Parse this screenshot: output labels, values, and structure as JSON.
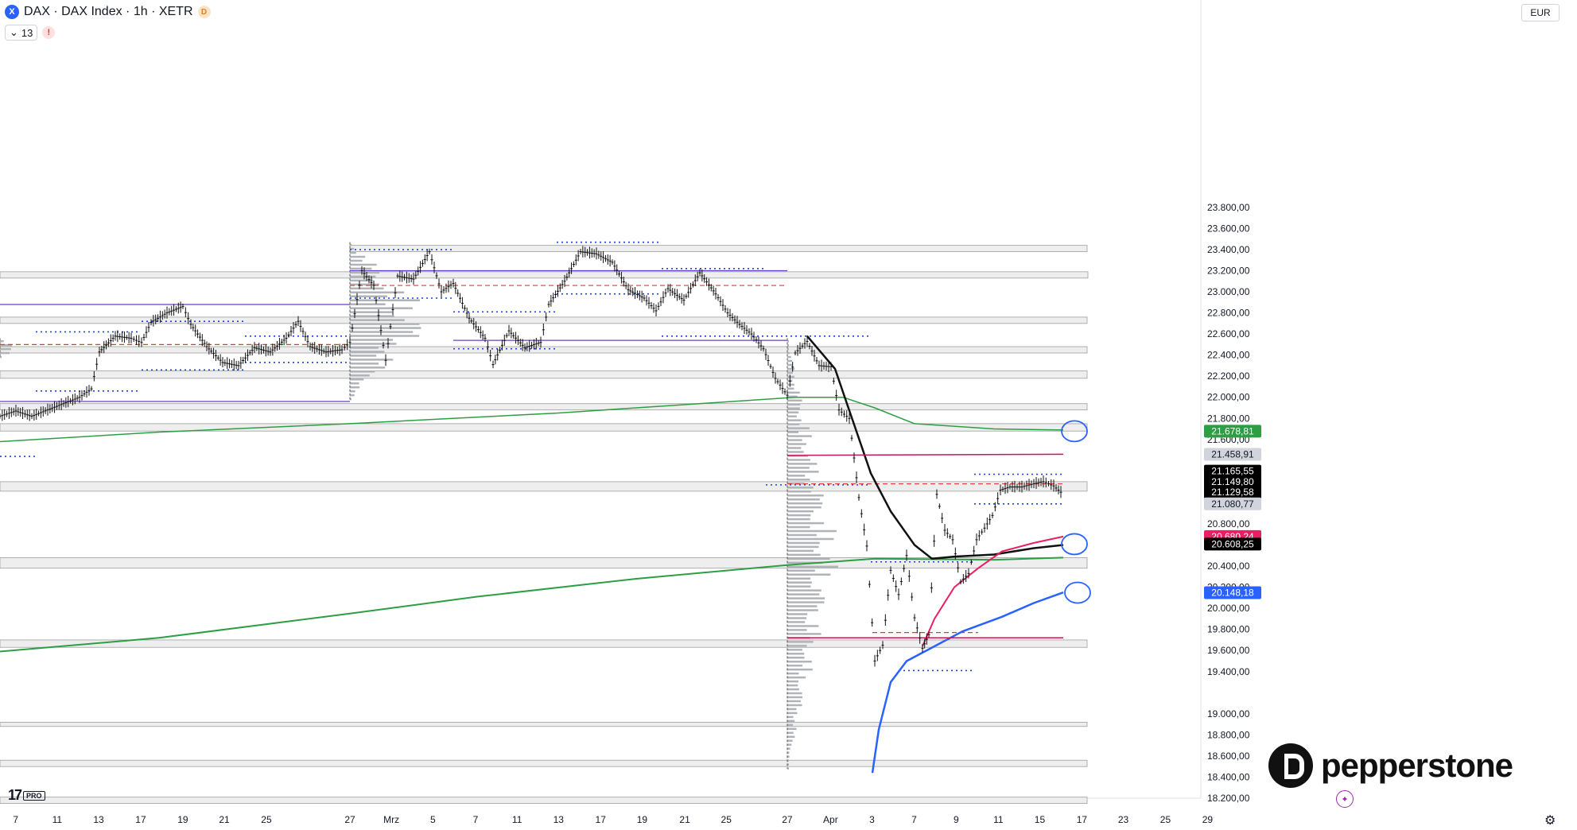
{
  "header": {
    "symbol_icon": "X",
    "title": "DAX · DAX Index · 1h · XETR",
    "badge": "D",
    "indicator_count": "13",
    "warning": "!"
  },
  "currency": "EUR",
  "branding": {
    "tv": "17",
    "pro": "PRO",
    "name": "pepperstone"
  },
  "icons": {
    "settings": "gear-icon",
    "assistant": "sparkle-icon",
    "symbol": "exchange-icon"
  },
  "chart_data": {
    "type": "candlestick",
    "ylim": [
      18200,
      23950
    ],
    "y_ticks": [
      "23.800,00",
      "23.600,00",
      "23.400,00",
      "23.200,00",
      "23.000,00",
      "22.800,00",
      "22.600,00",
      "22.400,00",
      "22.200,00",
      "22.000,00",
      "21.800,00",
      "21.600,00",
      "20.800,00",
      "20.400,00",
      "20.200,00",
      "20.000,00",
      "19.800,00",
      "19.600,00",
      "19.400,00",
      "19.000,00",
      "18.800,00",
      "18.600,00",
      "18.400,00",
      "18.200,00"
    ],
    "y_tick_values": [
      23800,
      23600,
      23400,
      23200,
      23000,
      22800,
      22600,
      22400,
      22200,
      22000,
      21800,
      21600,
      20800,
      20400,
      20200,
      20000,
      19800,
      19600,
      19400,
      19000,
      18800,
      18600,
      18400,
      18200
    ],
    "x_ticks": [
      "7",
      "11",
      "13",
      "17",
      "19",
      "21",
      "25",
      "27",
      "Mrz",
      "5",
      "7",
      "11",
      "13",
      "17",
      "19",
      "21",
      "25",
      "27",
      "Apr",
      "3",
      "7",
      "9",
      "11",
      "15",
      "17",
      "23",
      "25",
      "29"
    ],
    "price_labels": [
      {
        "text": "21.678,81",
        "value": 21678.81,
        "bg": "#2e9e44",
        "fg": "#ffffff"
      },
      {
        "text": "21.458,91",
        "value": 21458.91,
        "bg": "#d1d4dc",
        "fg": "#131722"
      },
      {
        "text": "21.165,55",
        "value": 21300,
        "bg": "#000000",
        "fg": "#ffffff"
      },
      {
        "text": "21.149,80",
        "value": 21200,
        "bg": "#000000",
        "fg": "#ffffff"
      },
      {
        "text": "21.129,58",
        "value": 21100,
        "bg": "#000000",
        "fg": "#ffffff"
      },
      {
        "text": "21.080,77",
        "value": 20990,
        "bg": "#d1d4dc",
        "fg": "#131722"
      },
      {
        "text": "20.680,24",
        "value": 20680.24,
        "bg": "#e91e63",
        "fg": "#ffffff"
      },
      {
        "text": "20.608,25",
        "value": 20608.25,
        "bg": "#000000",
        "fg": "#ffffff"
      },
      {
        "text": "20.148,18",
        "value": 20148.18,
        "bg": "#2962ff",
        "fg": "#ffffff"
      }
    ],
    "zones": [
      {
        "from": 23380,
        "to": 23440,
        "x0": 440,
        "x1": 1367
      },
      {
        "from": 23130,
        "to": 23190,
        "x0": 0,
        "x1": 1368
      },
      {
        "from": 22700,
        "to": 22760,
        "x0": 0,
        "x1": 1367
      },
      {
        "from": 22420,
        "to": 22480,
        "x0": 0,
        "x1": 1367
      },
      {
        "from": 22180,
        "to": 22250,
        "x0": 0,
        "x1": 1367
      },
      {
        "from": 21880,
        "to": 21940,
        "x0": 0,
        "x1": 1367
      },
      {
        "from": 21680,
        "to": 21750,
        "x0": 0,
        "x1": 1367
      },
      {
        "from": 21110,
        "to": 21200,
        "x0": 0,
        "x1": 1367
      },
      {
        "from": 20380,
        "to": 20480,
        "x0": 0,
        "x1": 1367
      },
      {
        "from": 19630,
        "to": 19700,
        "x0": 0,
        "x1": 1367
      },
      {
        "from": 18880,
        "to": 18920,
        "x0": 0,
        "x1": 1367
      },
      {
        "from": 18500,
        "to": 18560,
        "x0": 0,
        "x1": 1367
      },
      {
        "from": 18150,
        "to": 18210,
        "x0": 0,
        "x1": 1367
      }
    ],
    "series": [
      {
        "name": "",
        "color": "#2e9e44",
        "width": 1.5,
        "points": [
          [
            0,
            21580
          ],
          [
            200,
            21670
          ],
          [
            440,
            21750
          ],
          [
            700,
            21850
          ],
          [
            900,
            21950
          ],
          [
            1000,
            22000
          ],
          [
            1060,
            22000
          ],
          [
            1100,
            21900
          ],
          [
            1150,
            21750
          ],
          [
            1250,
            21700
          ],
          [
            1337,
            21690
          ]
        ]
      },
      {
        "name": "",
        "color": "#2e9e44",
        "width": 2,
        "points": [
          [
            0,
            19590
          ],
          [
            200,
            19720
          ],
          [
            440,
            19950
          ],
          [
            600,
            20110
          ],
          [
            800,
            20280
          ],
          [
            990,
            20410
          ],
          [
            1100,
            20470
          ],
          [
            1250,
            20460
          ],
          [
            1337,
            20480
          ]
        ]
      },
      {
        "name": "",
        "color": "#111111",
        "width": 2.5,
        "points": [
          [
            1015,
            22580
          ],
          [
            1050,
            22270
          ],
          [
            1075,
            21720
          ],
          [
            1095,
            21280
          ],
          [
            1120,
            20920
          ],
          [
            1150,
            20600
          ],
          [
            1172,
            20470
          ],
          [
            1200,
            20490
          ],
          [
            1250,
            20510
          ],
          [
            1300,
            20570
          ],
          [
            1337,
            20600
          ]
        ]
      },
      {
        "name": "",
        "color": "#e91e63",
        "width": 2,
        "points": [
          [
            1160,
            19640
          ],
          [
            1175,
            19900
          ],
          [
            1200,
            20200
          ],
          [
            1230,
            20380
          ],
          [
            1260,
            20540
          ],
          [
            1300,
            20620
          ],
          [
            1337,
            20680
          ]
        ]
      },
      {
        "name": "",
        "color": "#2962ff",
        "width": 2.5,
        "points": [
          [
            1097,
            18440
          ],
          [
            1105,
            18850
          ],
          [
            1120,
            19300
          ],
          [
            1140,
            19500
          ],
          [
            1170,
            19620
          ],
          [
            1210,
            19780
          ],
          [
            1260,
            19920
          ],
          [
            1300,
            20050
          ],
          [
            1337,
            20150
          ]
        ]
      },
      {
        "name": "",
        "color": "#c2185b",
        "width": 1.5,
        "points": [
          [
            990,
            21450
          ],
          [
            1337,
            21460
          ]
        ]
      },
      {
        "name": "",
        "color": "#c2185b",
        "width": 1.5,
        "points": [
          [
            990,
            19720
          ],
          [
            1337,
            19720
          ]
        ]
      },
      {
        "name": "",
        "color": "#6a3fc8",
        "width": 1.2,
        "points": [
          [
            0,
            22880
          ],
          [
            440,
            22880
          ]
        ]
      },
      {
        "name": "",
        "color": "#6a3fc8",
        "width": 1.2,
        "points": [
          [
            0,
            21960
          ],
          [
            440,
            21960
          ]
        ]
      },
      {
        "name": "",
        "color": "#6a3fc8",
        "width": 1.2,
        "points": [
          [
            440,
            23200
          ],
          [
            990,
            23200
          ]
        ]
      },
      {
        "name": "",
        "color": "#6a3fc8",
        "width": 1.2,
        "points": [
          [
            570,
            22540
          ],
          [
            990,
            22540
          ]
        ]
      }
    ],
    "dashed_levels": [
      {
        "y": 22500,
        "x0": 0,
        "x1": 440,
        "color": "#e53935"
      },
      {
        "y": 23060,
        "x0": 440,
        "x1": 580,
        "color": "#e53935"
      },
      {
        "y": 23060,
        "x0": 580,
        "x1": 990,
        "color": "#e53935"
      },
      {
        "y": 21180,
        "x0": 990,
        "x1": 1337,
        "color": "#e53935"
      },
      {
        "y": 19770,
        "x0": 1097,
        "x1": 1230,
        "color": "#e53935"
      }
    ],
    "dotted_levels": [
      {
        "y": 22620,
        "x0": 45,
        "x1": 175
      },
      {
        "y": 22060,
        "x0": 45,
        "x1": 175
      },
      {
        "y": 22720,
        "x0": 178,
        "x1": 308
      },
      {
        "y": 22260,
        "x0": 178,
        "x1": 308
      },
      {
        "y": 22580,
        "x0": 308,
        "x1": 438
      },
      {
        "y": 22330,
        "x0": 308,
        "x1": 438
      },
      {
        "y": 23400,
        "x0": 440,
        "x1": 570
      },
      {
        "y": 22940,
        "x0": 440,
        "x1": 570
      },
      {
        "y": 22810,
        "x0": 570,
        "x1": 700
      },
      {
        "y": 22460,
        "x0": 570,
        "x1": 700
      },
      {
        "y": 23470,
        "x0": 700,
        "x1": 832
      },
      {
        "y": 22980,
        "x0": 700,
        "x1": 832
      },
      {
        "y": 23220,
        "x0": 832,
        "x1": 963
      },
      {
        "y": 22580,
        "x0": 832,
        "x1": 1095
      },
      {
        "y": 21170,
        "x0": 963,
        "x1": 1095
      },
      {
        "y": 20440,
        "x0": 1095,
        "x1": 1225
      },
      {
        "y": 19410,
        "x0": 1130,
        "x1": 1225
      },
      {
        "y": 21270,
        "x0": 1225,
        "x1": 1337
      },
      {
        "y": 20990,
        "x0": 1225,
        "x1": 1337
      },
      {
        "y": 21440,
        "x0": 0,
        "x1": 45
      }
    ],
    "price_path": [
      [
        0,
        21820
      ],
      [
        20,
        21870
      ],
      [
        40,
        21820
      ],
      [
        60,
        21880
      ],
      [
        80,
        21940
      ],
      [
        100,
        22000
      ],
      [
        115,
        22080
      ],
      [
        125,
        22430
      ],
      [
        145,
        22580
      ],
      [
        165,
        22560
      ],
      [
        178,
        22520
      ],
      [
        190,
        22710
      ],
      [
        210,
        22800
      ],
      [
        230,
        22860
      ],
      [
        240,
        22690
      ],
      [
        260,
        22480
      ],
      [
        280,
        22330
      ],
      [
        300,
        22300
      ],
      [
        320,
        22470
      ],
      [
        340,
        22430
      ],
      [
        360,
        22560
      ],
      [
        375,
        22720
      ],
      [
        390,
        22480
      ],
      [
        410,
        22430
      ],
      [
        430,
        22450
      ],
      [
        440,
        22520
      ],
      [
        455,
        23200
      ],
      [
        470,
        23060
      ],
      [
        485,
        22350
      ],
      [
        500,
        23150
      ],
      [
        520,
        23120
      ],
      [
        540,
        23380
      ],
      [
        555,
        23000
      ],
      [
        570,
        23080
      ],
      [
        590,
        22750
      ],
      [
        610,
        22560
      ],
      [
        620,
        22310
      ],
      [
        640,
        22630
      ],
      [
        660,
        22470
      ],
      [
        680,
        22520
      ],
      [
        690,
        22880
      ],
      [
        710,
        23100
      ],
      [
        730,
        23380
      ],
      [
        750,
        23360
      ],
      [
        770,
        23280
      ],
      [
        790,
        23020
      ],
      [
        810,
        22940
      ],
      [
        825,
        22820
      ],
      [
        840,
        23030
      ],
      [
        860,
        22920
      ],
      [
        880,
        23180
      ],
      [
        900,
        22980
      ],
      [
        915,
        22800
      ],
      [
        930,
        22690
      ],
      [
        945,
        22600
      ],
      [
        960,
        22460
      ],
      [
        975,
        22180
      ],
      [
        990,
        22020
      ],
      [
        1000,
        22420
      ],
      [
        1015,
        22530
      ],
      [
        1030,
        22300
      ],
      [
        1045,
        22290
      ],
      [
        1055,
        21880
      ],
      [
        1068,
        21800
      ],
      [
        1080,
        21050
      ],
      [
        1090,
        20590
      ],
      [
        1100,
        19500
      ],
      [
        1110,
        19650
      ],
      [
        1120,
        20360
      ],
      [
        1130,
        20130
      ],
      [
        1140,
        20500
      ],
      [
        1150,
        19910
      ],
      [
        1160,
        19620
      ],
      [
        1168,
        19750
      ],
      [
        1178,
        21080
      ],
      [
        1188,
        20740
      ],
      [
        1198,
        20650
      ],
      [
        1208,
        20250
      ],
      [
        1218,
        20330
      ],
      [
        1228,
        20650
      ],
      [
        1238,
        20760
      ],
      [
        1248,
        20880
      ],
      [
        1258,
        21120
      ],
      [
        1270,
        21150
      ],
      [
        1285,
        21150
      ],
      [
        1300,
        21180
      ],
      [
        1312,
        21200
      ],
      [
        1325,
        21160
      ],
      [
        1337,
        21080
      ]
    ],
    "volume_profiles": [
      {
        "x": 0,
        "yfrom": 22380,
        "yto": 22560,
        "dir": "right",
        "max": 30
      },
      {
        "x": 440,
        "yfrom": 21980,
        "yto": 23470,
        "dir": "right",
        "max": 120
      },
      {
        "x": 990,
        "yfrom": 18480,
        "yto": 22560,
        "dir": "right",
        "max": 70
      }
    ],
    "circles": [
      {
        "x": 1351,
        "value": 21678.81
      },
      {
        "x": 1351,
        "value": 20608.25
      },
      {
        "x": 1355,
        "value": 20148.18
      }
    ],
    "grid": false
  }
}
